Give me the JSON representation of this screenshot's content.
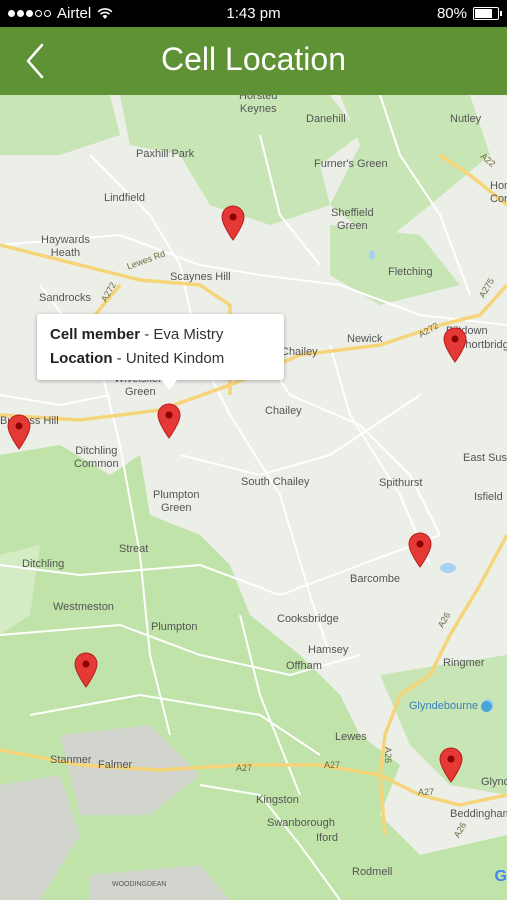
{
  "status_bar": {
    "carrier": "Airtel",
    "time": "1:43 pm",
    "battery": "80%",
    "battery_level": 0.8,
    "icons": [
      "signal-dots-icon",
      "wifi-icon",
      "battery-icon"
    ]
  },
  "header": {
    "title": "Cell Location",
    "back_icon": "chevron-left-icon",
    "color": "#5f9235"
  },
  "info_window": {
    "member_label": "Cell member",
    "member_value": "Eva Mistry",
    "location_label": "Location",
    "location_value": "United Kindom",
    "separator": " - "
  },
  "map": {
    "marker_color": "#e53935",
    "attribution": "G",
    "places": [
      {
        "name": "Horsted\nKeynes"
      },
      {
        "name": "Danehill"
      },
      {
        "name": "Nutley"
      },
      {
        "name": "Paxhill Park"
      },
      {
        "name": "Furner's Green"
      },
      {
        "name": "Lindfield"
      },
      {
        "name": "Sheffield\nGreen"
      },
      {
        "name": "Haywards\nHeath"
      },
      {
        "name": "Scaynes Hill"
      },
      {
        "name": "Fletching"
      },
      {
        "name": "Sandrocks"
      },
      {
        "name": "Newick"
      },
      {
        "name": "Piltdown"
      },
      {
        "name": "Shortbridge"
      },
      {
        "name": "Chailey"
      },
      {
        "name": "Chailey"
      },
      {
        "name": "Wivelsfield\nGreen"
      },
      {
        "name": "Ditchling\nCommon"
      },
      {
        "name": "South Chailey"
      },
      {
        "name": "Spithurst"
      },
      {
        "name": "East Sussex"
      },
      {
        "name": "Plumpton\nGreen"
      },
      {
        "name": "Isfield"
      },
      {
        "name": "Streat"
      },
      {
        "name": "Barcombe"
      },
      {
        "name": "Ditchling"
      },
      {
        "name": "Westmeston"
      },
      {
        "name": "Plumpton"
      },
      {
        "name": "Cooksbridge"
      },
      {
        "name": "Hamsey"
      },
      {
        "name": "Offham"
      },
      {
        "name": "Ringmer"
      },
      {
        "name": "Glyndebourne"
      },
      {
        "name": "Lewes"
      },
      {
        "name": "Stanmer"
      },
      {
        "name": "Falmer"
      },
      {
        "name": "Glynde"
      },
      {
        "name": "Kingston"
      },
      {
        "name": "Beddingham"
      },
      {
        "name": "Swanborough"
      },
      {
        "name": "Iford"
      },
      {
        "name": "Rodmell"
      },
      {
        "name": "WOODINGDEAN"
      },
      {
        "name": "Burgess Hill"
      },
      {
        "name": "Hor\nCor"
      }
    ],
    "roads": [
      "A272",
      "A272",
      "A275",
      "A22",
      "A26",
      "A26",
      "A27",
      "A27",
      "A27",
      "A26",
      "Lewes Rd"
    ]
  }
}
